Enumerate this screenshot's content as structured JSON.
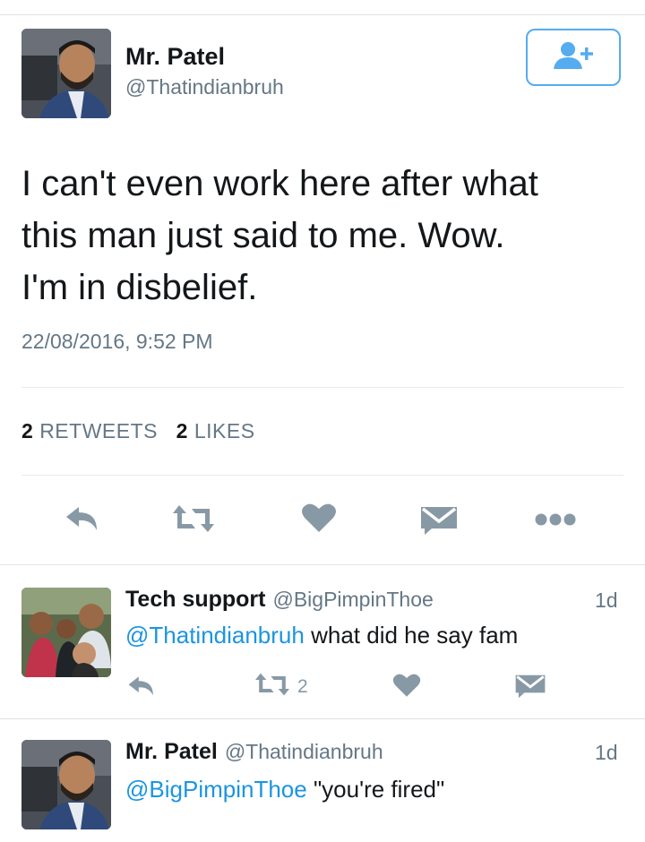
{
  "tweet": {
    "author_name": "Mr. Patel",
    "author_handle": "@Thatindianbruh",
    "text": "I can't even work here after what\nthis man just said to me. Wow.\nI'm in disbelief.",
    "timestamp": "22/08/2016, 9:52 PM",
    "retweets_count": "2",
    "retweets_label": "RETWEETS",
    "likes_count": "2",
    "likes_label": "LIKES"
  },
  "actions": {
    "icons": [
      "reply-icon",
      "retweet-icon",
      "heart-icon",
      "dm-icon",
      "more-icon"
    ]
  },
  "replies": [
    {
      "author_name": "Tech support",
      "author_handle": "@BigPimpinThoe",
      "time": "1d",
      "mention": "@Thatindianbruh",
      "text": "what did he say fam",
      "retweet_count": "2"
    },
    {
      "author_name": "Mr. Patel",
      "author_handle": "@Thatindianbruh",
      "time": "1d",
      "mention": "@BigPimpinThoe",
      "text": "\"you're fired\""
    }
  ],
  "colors": {
    "accent": "#1b95e0",
    "icon_gray": "#8899a6",
    "text_gray": "#657786"
  }
}
